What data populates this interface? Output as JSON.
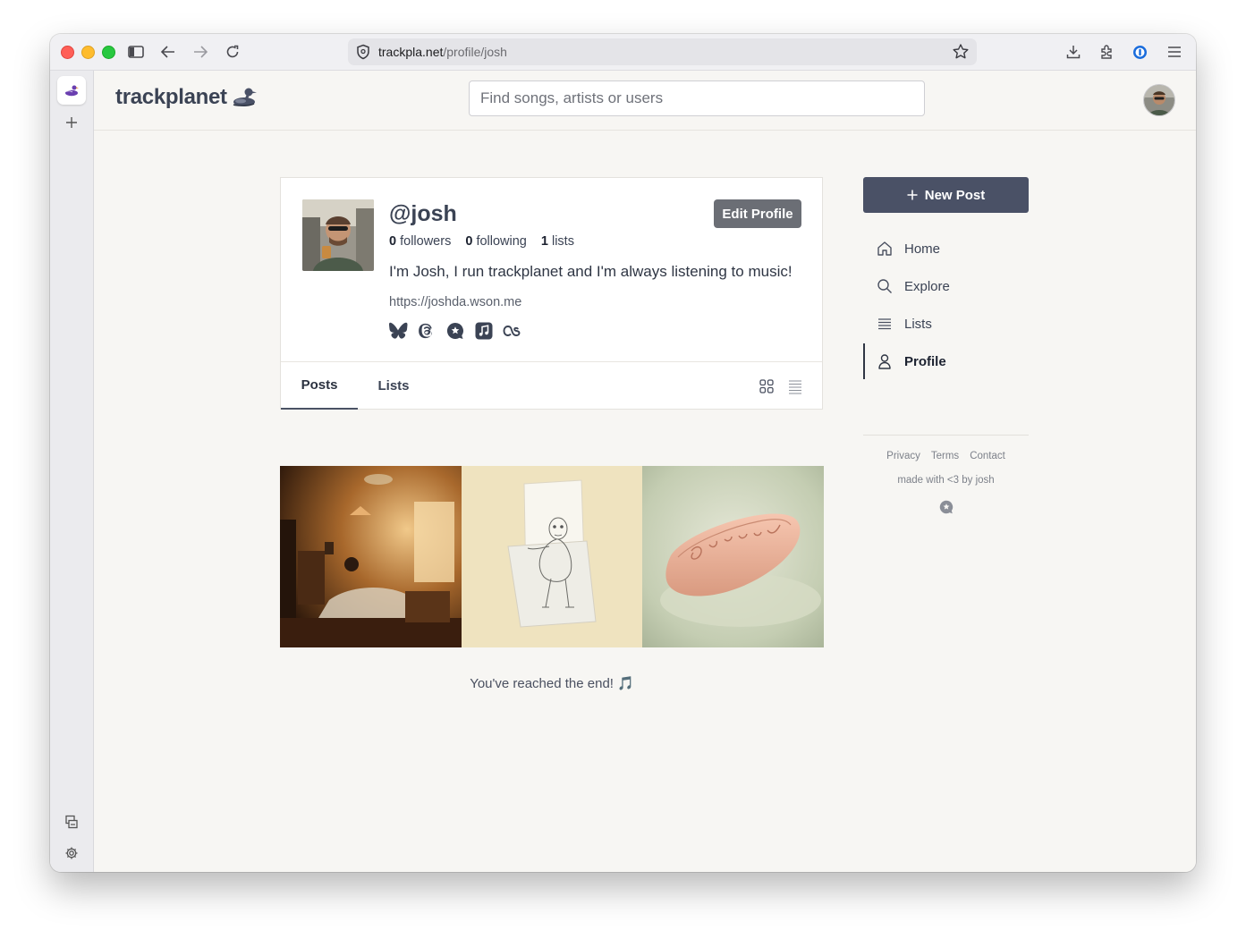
{
  "browser": {
    "url_host": "trackpla.net",
    "url_path": "/profile/josh"
  },
  "site": {
    "logo_text": "trackplanet",
    "search_placeholder": "Find songs, artists or users"
  },
  "profile": {
    "handle": "@josh",
    "edit_label": "Edit Profile",
    "followers_count": "0",
    "followers_label": "followers",
    "following_count": "0",
    "following_label": "following",
    "lists_count": "1",
    "lists_label": "lists",
    "bio": "I'm Josh, I run trackplanet and I'm always listening to music!",
    "link": "https://joshda.wson.me",
    "socials": [
      "bluesky-icon",
      "threads-icon",
      "letterboxd-icon",
      "apple-music-icon",
      "lastfm-icon"
    ]
  },
  "tabs": {
    "posts": "Posts",
    "lists": "Lists"
  },
  "posts": [
    {
      "name": "post-cover-bedroom",
      "colors": [
        "#3a2010",
        "#b87a3c"
      ]
    },
    {
      "name": "post-cover-drawing",
      "colors": [
        "#efe2bd",
        "#f6f3ea"
      ]
    },
    {
      "name": "post-cover-soap",
      "colors": [
        "#c9d0b8",
        "#e9b8a0"
      ]
    }
  ],
  "end_text": "You've reached the end! 🎵",
  "nav": {
    "new_post": "New Post",
    "home": "Home",
    "explore": "Explore",
    "lists": "Lists",
    "profile": "Profile"
  },
  "footer": {
    "privacy": "Privacy",
    "terms": "Terms",
    "contact": "Contact",
    "made_with": "made with <3 by josh"
  },
  "colors": {
    "accent": "#4a5166",
    "background": "#f7f6f3"
  }
}
